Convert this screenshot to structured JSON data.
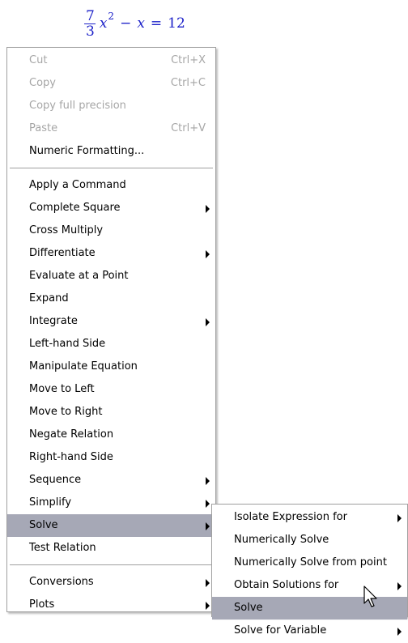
{
  "equation": {
    "numerator": "7",
    "denominator": "3",
    "variable": "x",
    "exponent": "2",
    "minus": "−",
    "variable2": "x",
    "equals": "=",
    "rhs": "12",
    "color": "#1d22c9"
  },
  "main_menu": {
    "cut": {
      "label": "Cut",
      "shortcut": "Ctrl+X"
    },
    "copy": {
      "label": "Copy",
      "shortcut": "Ctrl+C"
    },
    "copy_full": {
      "label": "Copy full precision"
    },
    "paste": {
      "label": "Paste",
      "shortcut": "Ctrl+V"
    },
    "numeric_formatting": {
      "label": "Numeric Formatting..."
    },
    "apply_command": {
      "label": "Apply a Command"
    },
    "complete_square": {
      "label": "Complete Square"
    },
    "cross_multiply": {
      "label": "Cross Multiply"
    },
    "differentiate": {
      "label": "Differentiate"
    },
    "evaluate_point": {
      "label": "Evaluate at a Point"
    },
    "expand": {
      "label": "Expand"
    },
    "integrate": {
      "label": "Integrate"
    },
    "left_hand_side": {
      "label": "Left-hand Side"
    },
    "manipulate_equation": {
      "label": "Manipulate Equation"
    },
    "move_left": {
      "label": "Move to Left"
    },
    "move_right": {
      "label": "Move to Right"
    },
    "negate_relation": {
      "label": "Negate Relation"
    },
    "right_hand_side": {
      "label": "Right-hand Side"
    },
    "sequence": {
      "label": "Sequence"
    },
    "simplify": {
      "label": "Simplify"
    },
    "solve": {
      "label": "Solve"
    },
    "test_relation": {
      "label": "Test Relation"
    },
    "conversions": {
      "label": "Conversions"
    },
    "plots": {
      "label": "Plots"
    }
  },
  "sub_menu": {
    "isolate_expression": {
      "label": "Isolate Expression for"
    },
    "numerically_solve": {
      "label": "Numerically Solve"
    },
    "numerically_solve_point": {
      "label": "Numerically Solve from point"
    },
    "obtain_solutions": {
      "label": "Obtain Solutions for"
    },
    "solve": {
      "label": "Solve"
    },
    "solve_for_variable": {
      "label": "Solve for Variable"
    }
  },
  "colors": {
    "highlight": "#a6a8b6",
    "disabled_text": "#a6a6a6",
    "border": "#a0a0a0"
  }
}
